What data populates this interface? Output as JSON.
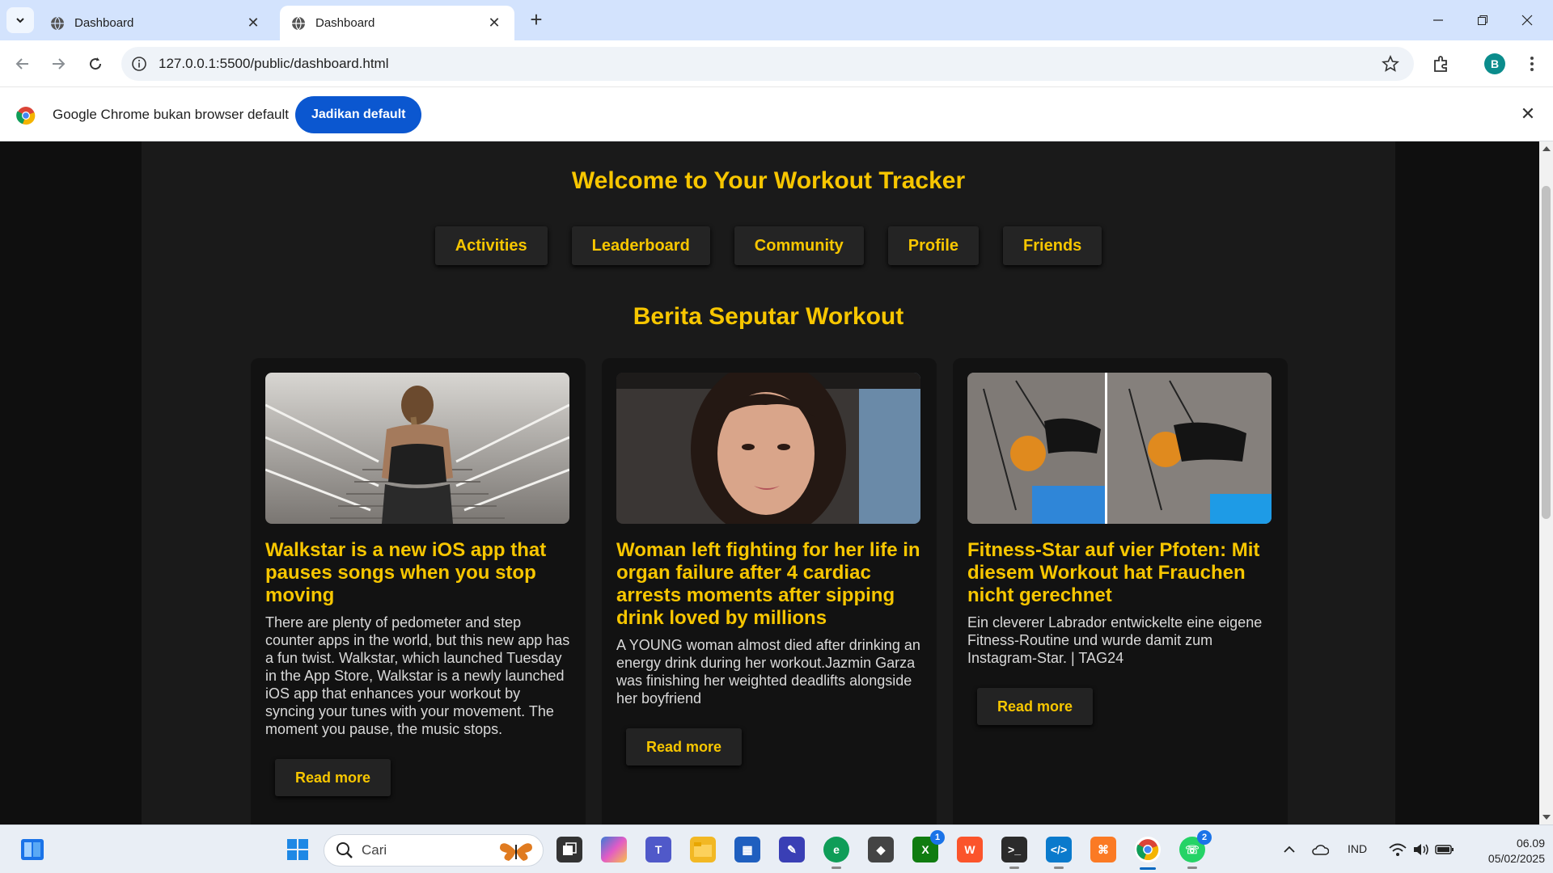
{
  "browser": {
    "tabs": [
      {
        "title": "Dashboard",
        "active": false
      },
      {
        "title": "Dashboard",
        "active": true
      }
    ],
    "url": "127.0.0.1:5500/public/dashboard.html",
    "profile_initial": "B",
    "infobar": {
      "message": "Google Chrome bukan browser default",
      "button_label": "Jadikan default"
    }
  },
  "page": {
    "title": "Welcome to Your Workout Tracker",
    "nav": [
      "Activities",
      "Leaderboard",
      "Community",
      "Profile",
      "Friends"
    ],
    "section_title": "Berita Seputar Workout",
    "articles": [
      {
        "headline": "Walkstar is a new iOS app that pauses songs when you stop moving",
        "description": "There are plenty of pedometer and step counter apps in the world, but this new app has a fun twist. Walkstar, which launched Tuesday in the App Store, Walkstar is a newly launched iOS app that enhances your workout by syncing your tunes with your movement. The moment you pause, the music stops.",
        "button": "Read more"
      },
      {
        "headline": "Woman left fighting for her life in organ failure after 4 cardiac arrests moments after sipping drink loved by millions",
        "description": "A YOUNG woman almost died after drinking an energy drink during her workout.Jazmin Garza was finishing her weighted deadlifts alongside her boyfriend",
        "button": "Read more"
      },
      {
        "headline": "Fitness-Star auf vier Pfoten: Mit diesem Workout hat Frauchen nicht gerechnet",
        "description": "Ein cleverer Labrador entwickelte eine eigene Fitness-Routine und wurde damit zum Instagram-Star. | TAG24",
        "button": "Read more"
      }
    ]
  },
  "taskbar": {
    "search_placeholder": "Cari",
    "badges": {
      "xbox": "1",
      "whatsapp": "2"
    },
    "language": "IND",
    "time": "06.09",
    "date": "05/02/2025"
  },
  "colors": {
    "accent": "#f7c600",
    "page_bg": "#0f0f0f",
    "container_bg": "#1a1a1a",
    "card_bg": "#121212",
    "chrome_blue": "#0b57d0"
  }
}
